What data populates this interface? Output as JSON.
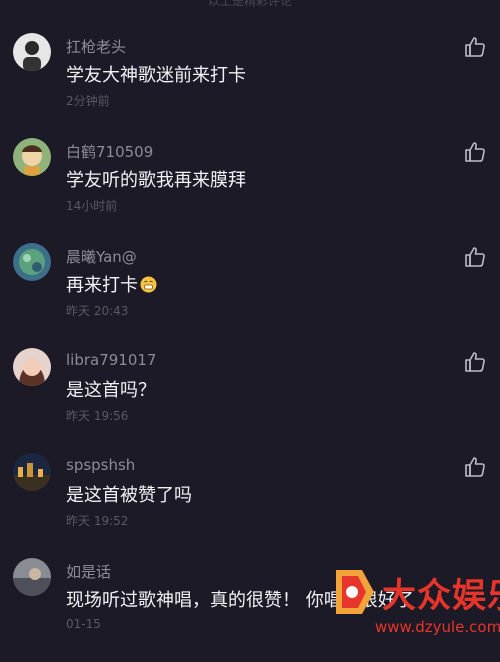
{
  "top_partial_text": "以上是精彩评论",
  "comments": [
    {
      "username": "扛枪老头",
      "text": "学友大神歌迷前来打卡",
      "time": "2分钟前",
      "avatar_icon": "man-portrait-avatar",
      "avatar_color": "#c9c9c9"
    },
    {
      "username": "白鹤710509",
      "text": "学友听的歌我再来膜拜",
      "time": "14小时前",
      "avatar_icon": "cartoon-avatar",
      "avatar_color": "#d9a441"
    },
    {
      "username": "晨曦Yan@",
      "text": "再来打卡",
      "time": "昨天 20:43",
      "avatar_icon": "landscape-avatar",
      "avatar_color": "#4a9a8a"
    },
    {
      "username": "libra791017",
      "text": "是这首吗？",
      "time": "昨天 19:56",
      "avatar_icon": "woman-portrait-avatar",
      "avatar_color": "#d8a49a"
    },
    {
      "username": "spspshsh",
      "text": "是这首被赞了吗",
      "time": "昨天 19:52",
      "avatar_icon": "night-city-avatar",
      "avatar_color": "#203050"
    },
    {
      "username": "如是话",
      "text": "现场听过歌神唱，真的很赞！ 你唱得很好了",
      "time": "01-15",
      "avatar_icon": "photo-avatar",
      "avatar_color": "#7d7f88"
    }
  ],
  "emoji_icon": "grin-emoji-icon",
  "like_icon": "thumbs-up-icon",
  "watermark": {
    "brand": "大众娱乐",
    "url": "www.dzyule.com",
    "color": "#e8352b"
  }
}
